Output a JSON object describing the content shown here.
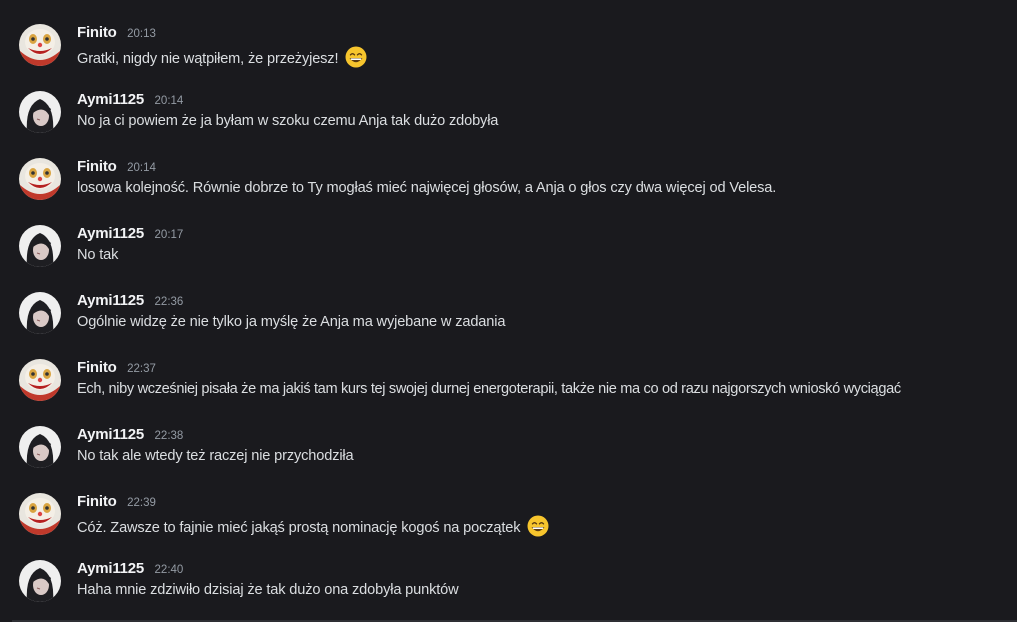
{
  "users": {
    "finito": {
      "name": "Finito",
      "avatar": "clown-face-avatar"
    },
    "aymi": {
      "name": "Aymi1125",
      "avatar": "anime-girl-avatar"
    }
  },
  "messages": [
    {
      "author": "Finito",
      "time": "20:13",
      "text": "Gratki, nigdy nie wątpiłem, że przeżyjesz!",
      "emoji": "grinning-face-with-smiling-eyes"
    },
    {
      "author": "Aymi1125",
      "time": "20:14",
      "text": "No ja ci powiem że ja byłam w szoku czemu Anja tak dużo zdobyła",
      "emoji": ""
    },
    {
      "author": "Finito",
      "time": "20:14",
      "text": "losowa kolejność. Równie dobrze to Ty mogłaś mieć najwięcej głosów, a Anja o głos czy dwa więcej od Velesa.",
      "emoji": ""
    },
    {
      "author": "Aymi1125",
      "time": "20:17",
      "text": "No tak",
      "emoji": ""
    },
    {
      "author": "Aymi1125",
      "time": "22:36",
      "text": "Ogólnie widzę że nie tylko ja myślę że Anja ma wyjebane w zadania",
      "emoji": ""
    },
    {
      "author": "Finito",
      "time": "22:37",
      "text": "Ech, niby wcześniej pisała że ma jakiś tam kurs tej swojej durnej energoterapii, także nie ma co od razu najgorszych wnioskó wyciągać",
      "emoji": ""
    },
    {
      "author": "Aymi1125",
      "time": "22:38",
      "text": "No tak ale wtedy też raczej nie przychodziła",
      "emoji": ""
    },
    {
      "author": "Finito",
      "time": "22:39",
      "text": "Cóż. Zawsze to fajnie mieć jakąś prostą nominację kogoś na początek",
      "emoji": "grinning-face-with-smiling-eyes"
    },
    {
      "author": "Aymi1125",
      "time": "22:40",
      "text": "Haha mnie zdziwiło dzisiaj że tak dużo ona zdobyła punktów",
      "emoji": ""
    }
  ],
  "colors": {
    "background": "#1a1a1e",
    "username": "#f2f3f5",
    "timestamp": "#949ba4",
    "message_text": "#dbdee1"
  }
}
